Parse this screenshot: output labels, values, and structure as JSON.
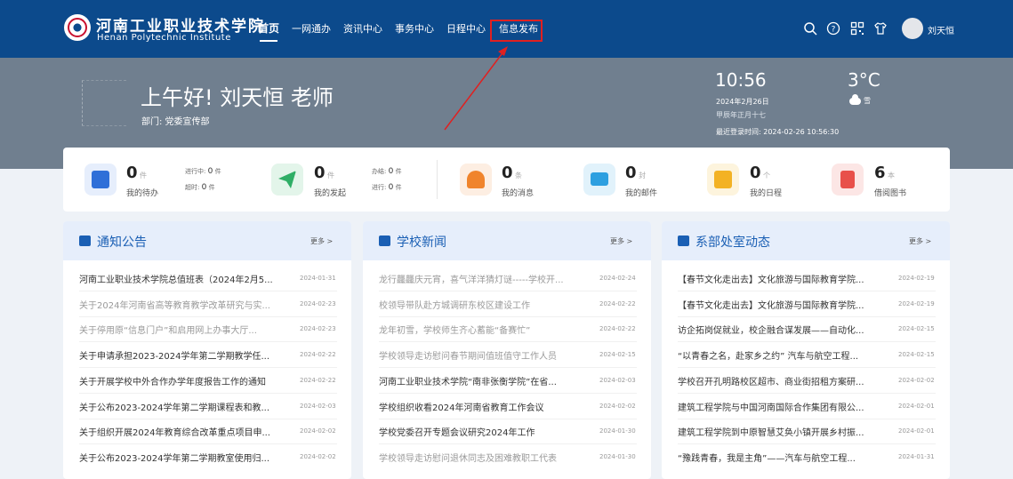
{
  "header": {
    "school_cn": "河南工业职业技术学院",
    "school_en": "Henan Polytechnic Institute",
    "nav": [
      "首页",
      "一网通办",
      "资讯中心",
      "事务中心",
      "日程中心",
      "信息发布"
    ],
    "username": "刘天恒"
  },
  "banner": {
    "greeting": "上午好! 刘天恒 老师",
    "dept": "部门: 党委宣传部",
    "time": "10:56",
    "date": "2024年2月26日",
    "lunar": "甲辰年正月十七",
    "last_login": "最近登录时间: 2024-02-26 10:56:30",
    "temp": "3°C",
    "weather": "雪"
  },
  "stats": [
    {
      "num": "0",
      "unit": "件",
      "label": "我的待办",
      "subs": [
        {
          "k": "进行中:",
          "v": "0",
          "u": "件"
        },
        {
          "k": "超时:",
          "v": "0",
          "u": "件"
        }
      ]
    },
    {
      "num": "0",
      "unit": "件",
      "label": "我的发起",
      "subs": [
        {
          "k": "办结:",
          "v": "0",
          "u": "件"
        },
        {
          "k": "进行:",
          "v": "0",
          "u": "件"
        }
      ]
    },
    {
      "num": "0",
      "unit": "条",
      "label": "我的消息"
    },
    {
      "num": "0",
      "unit": "封",
      "label": "我的邮件"
    },
    {
      "num": "0",
      "unit": "个",
      "label": "我的日程"
    },
    {
      "num": "6",
      "unit": "本",
      "label": "借阅图书"
    }
  ],
  "colors": {
    "header": "#0c4a8c",
    "banner": "#707f8f",
    "accent": "#1a5fb4",
    "highlight": "#e02020",
    "stat_icons": [
      "#2f6fd8",
      "#2fae66",
      "#f0842c",
      "#2d9fe0",
      "#f3b224",
      "#e8504a"
    ]
  },
  "icons": {
    "stats": [
      "todo-doc-icon",
      "send-plane-icon",
      "bell-icon",
      "mail-icon",
      "calendar-icon",
      "book-icon"
    ],
    "panels": [
      "announcement-icon",
      "news-icon",
      "trend-chart-icon"
    ]
  },
  "more_label": "更多 >",
  "panels": [
    {
      "title": "通知公告",
      "items": [
        {
          "title": "河南工业职业技术学院总值班表（2024年2月5...",
          "date": "2024-01-31",
          "read": false
        },
        {
          "title": "关于2024年河南省高等教育教学改革研究与实...",
          "date": "2024-02-23",
          "read": true
        },
        {
          "title": "关于停用原“信息门户”和启用网上办事大厅...",
          "date": "2024-02-23",
          "read": true
        },
        {
          "title": "关于申请承担2023-2024学年第二学期教学任...",
          "date": "2024-02-22",
          "read": false
        },
        {
          "title": "关于开展学校中外合作办学年度报告工作的通知",
          "date": "2024-02-22",
          "read": false
        },
        {
          "title": "关于公布2023-2024学年第二学期课程表和教...",
          "date": "2024-02-03",
          "read": false
        },
        {
          "title": "关于组织开展2024年教育综合改革重点项目申...",
          "date": "2024-02-02",
          "read": false
        },
        {
          "title": "关于公布2023-2024学年第二学期教室使用归...",
          "date": "2024-02-02",
          "read": false
        }
      ]
    },
    {
      "title": "学校新闻",
      "items": [
        {
          "title": "龙行龘龘庆元宵，喜气洋洋猜灯谜-----学校开...",
          "date": "2024-02-24",
          "read": true
        },
        {
          "title": "校领导带队赴方城调研东校区建设工作",
          "date": "2024-02-22",
          "read": true
        },
        {
          "title": "龙年初雪，学校师生齐心蓄能“备赛忙”",
          "date": "2024-02-22",
          "read": true
        },
        {
          "title": "学校领导走访慰问春节期间值班值守工作人员",
          "date": "2024-02-15",
          "read": true
        },
        {
          "title": "河南工业职业技术学院“南非张衡学院”在省...",
          "date": "2024-02-03",
          "read": false
        },
        {
          "title": "学校组织收看2024年河南省教育工作会议",
          "date": "2024-02-02",
          "read": false
        },
        {
          "title": "学校党委召开专题会议研究2024年工作",
          "date": "2024-01-30",
          "read": false
        },
        {
          "title": "学校领导走访慰问退休同志及困难教职工代表",
          "date": "2024-01-30",
          "read": true
        }
      ]
    },
    {
      "title": "系部处室动态",
      "items": [
        {
          "title": "【春节文化走出去】文化旅游与国际教育学院...",
          "date": "2024-02-19",
          "read": false
        },
        {
          "title": "【春节文化走出去】文化旅游与国际教育学院...",
          "date": "2024-02-19",
          "read": false
        },
        {
          "title": "访企拓岗促就业，校企融合谋发展——自动化...",
          "date": "2024-02-15",
          "read": false
        },
        {
          "title": "“以青春之名，赴家乡之约” 汽车与航空工程...",
          "date": "2024-02-15",
          "read": false
        },
        {
          "title": "学校召开孔明路校区超市、商业街招租方案研...",
          "date": "2024-02-02",
          "read": false
        },
        {
          "title": "建筑工程学院与中国河南国际合作集团有限公...",
          "date": "2024-02-01",
          "read": false
        },
        {
          "title": "建筑工程学院到中原智慧艾奂小镇开展乡村振...",
          "date": "2024-02-01",
          "read": false
        },
        {
          "title": "“豫践青春，我是主角”——汽车与航空工程...",
          "date": "2024-01-31",
          "read": false
        }
      ]
    }
  ]
}
